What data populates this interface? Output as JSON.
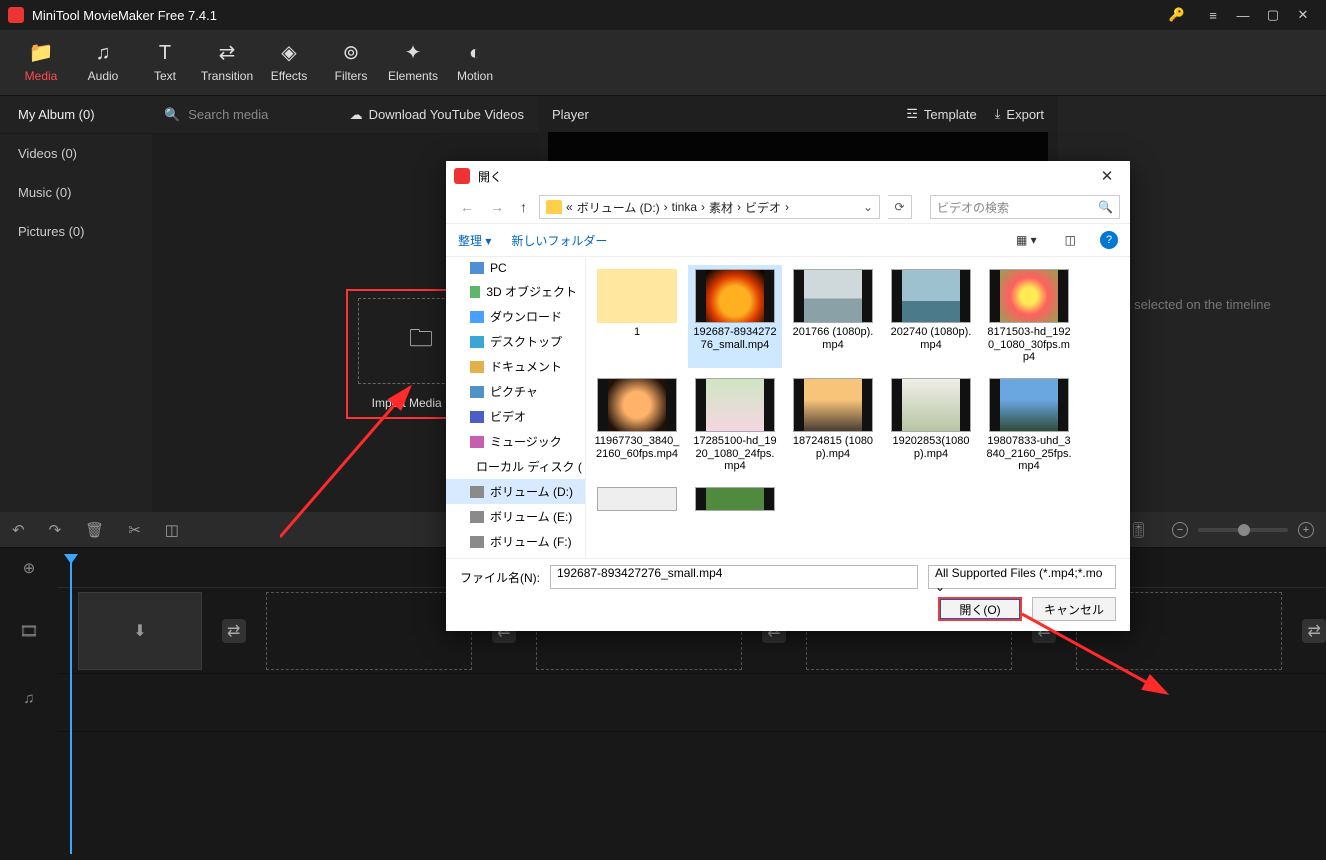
{
  "app": {
    "title": "MiniTool MovieMaker Free 7.4.1"
  },
  "tabs": {
    "media": "Media",
    "audio": "Audio",
    "text": "Text",
    "transition": "Transition",
    "effects": "Effects",
    "filters": "Filters",
    "elements": "Elements",
    "motion": "Motion"
  },
  "media": {
    "album": "My Album (0)",
    "search_placeholder": "Search media",
    "download_btn": "Download YouTube Videos",
    "side": {
      "videos": "Videos (0)",
      "music": "Music (0)",
      "pictures": "Pictures (0)"
    },
    "import_label": "Import Media Files"
  },
  "player": {
    "title": "Player",
    "template": "Template",
    "export": "Export"
  },
  "props": {
    "empty": "rial selected on the timeline"
  },
  "dialog": {
    "title": "開く",
    "path_prefix": "«",
    "path_segments": [
      "ボリューム (D:)",
      "tinka",
      "素材",
      "ビデオ"
    ],
    "search_placeholder": "ビデオの検索",
    "organize": "整理 ▾",
    "newfolder": "新しいフォルダー",
    "tree": [
      {
        "label": "PC",
        "cls": "pc"
      },
      {
        "label": "3D オブジェクト",
        "cls": "obj"
      },
      {
        "label": "ダウンロード",
        "cls": "dl"
      },
      {
        "label": "デスクトップ",
        "cls": "desk"
      },
      {
        "label": "ドキュメント",
        "cls": "doc"
      },
      {
        "label": "ピクチャ",
        "cls": "pic"
      },
      {
        "label": "ビデオ",
        "cls": "vid"
      },
      {
        "label": "ミュージック",
        "cls": "mus"
      },
      {
        "label": "ローカル ディスク (",
        "cls": "drv"
      },
      {
        "label": "ボリューム (D:)",
        "cls": "drv",
        "sel": true
      },
      {
        "label": "ボリューム (E:)",
        "cls": "drv"
      },
      {
        "label": "ボリューム (F:)",
        "cls": "drv"
      }
    ],
    "files": [
      {
        "name": "1",
        "cls": "folder"
      },
      {
        "name": "192687-893427276_small.mp4",
        "cls": "th-fire",
        "sel": true
      },
      {
        "name": "201766 (1080p).mp4",
        "cls": "th-sea"
      },
      {
        "name": "202740 (1080p).mp4",
        "cls": "th-sea2"
      },
      {
        "name": "8171503-hd_1920_1080_30fps.mp4",
        "cls": "th-flower"
      },
      {
        "name": "11967730_3840_2160_60fps.mp4",
        "cls": "th-jelly"
      },
      {
        "name": "17285100-hd_1920_1080_24fps.mp4",
        "cls": "th-flw2"
      },
      {
        "name": "18724815 (1080p).mp4",
        "cls": "th-dusk"
      },
      {
        "name": "19202853(1080p).mp4",
        "cls": "th-turb"
      },
      {
        "name": "19807833-uhd_3840_2160_25fps.mp4",
        "cls": "th-mtn"
      },
      {
        "name": "",
        "cls": "th-blank",
        "partial": true
      },
      {
        "name": "",
        "cls": "th-green",
        "partial": true
      }
    ],
    "filename_label": "ファイル名(N):",
    "filename_value": "192687-893427276_small.mp4",
    "filetype_value": "All Supported Files (*.mp4;*.mo",
    "open_btn": "開く(O)",
    "cancel_btn": "キャンセル"
  }
}
